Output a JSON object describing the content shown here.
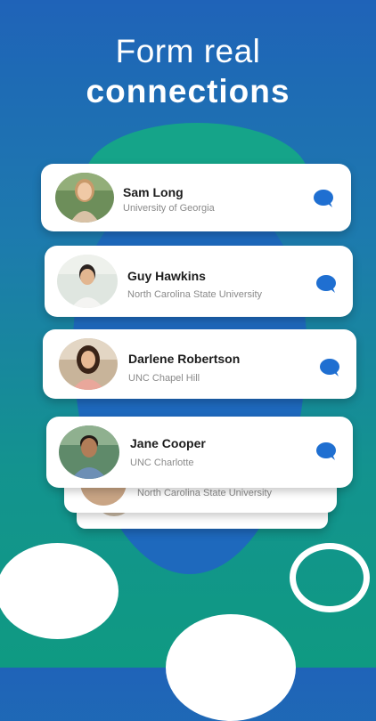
{
  "headline": {
    "line1": "Form real",
    "line2": "connections"
  },
  "colors": {
    "accent": "#1f6fd1",
    "background_top": "#1f63b8",
    "background_bottom": "#0f9a82"
  },
  "cards": [
    {
      "name": "Sam Long",
      "school": "University of Georgia",
      "icon": "chat-bubble-icon"
    },
    {
      "name": "Guy Hawkins",
      "school": "North Carolina State University",
      "icon": "chat-bubble-icon"
    },
    {
      "name": "Darlene Robertson",
      "school": "UNC Chapel Hill",
      "icon": "chat-bubble-icon"
    },
    {
      "name": "Jane Cooper",
      "school": "UNC Charlotte",
      "icon": "chat-bubble-icon"
    }
  ],
  "stacked_cards": [
    {
      "school": "North Carolina State University"
    }
  ]
}
